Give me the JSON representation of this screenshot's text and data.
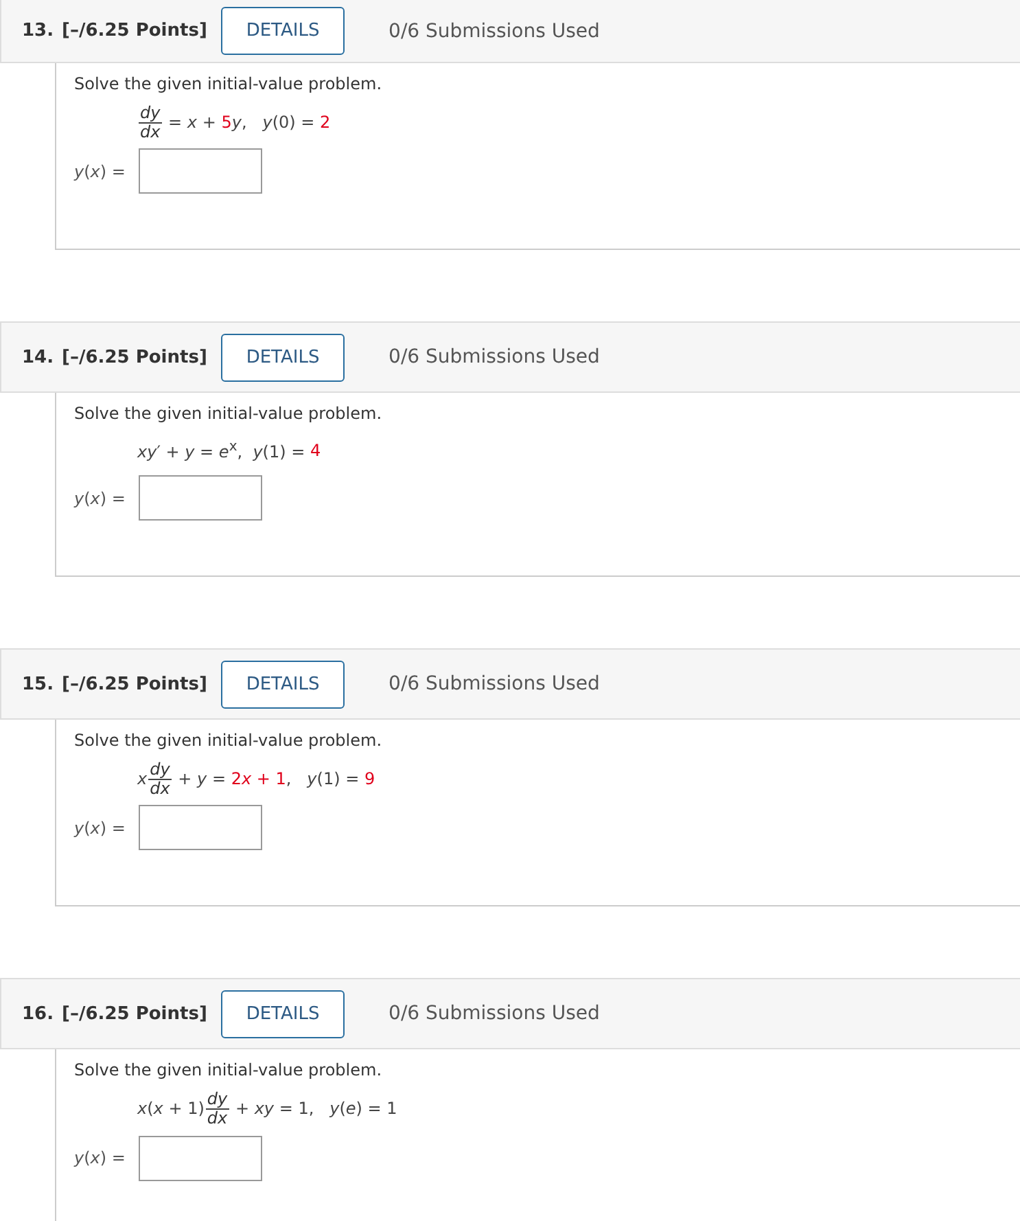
{
  "questions": [
    {
      "number": "13.",
      "points": "[–/6.25 Points]",
      "details_button": "DETAILS",
      "submissions": "0/6 Submissions Used",
      "prompt": "Solve the given initial-value problem.",
      "equation": [
        {
          "kind": "fraction",
          "numerator": "dy",
          "denominator": "dx"
        },
        {
          "kind": "text",
          "text": " = *x* + ",
          "highlight": false
        },
        {
          "kind": "text",
          "text": "5",
          "highlight": true
        },
        {
          "kind": "text",
          "text": "*y*,   *y*(0) = ",
          "highlight": false
        },
        {
          "kind": "text",
          "text": "2",
          "highlight": true
        }
      ],
      "answer_label": "*y*(*x*) ="
    },
    {
      "number": "14.",
      "points": "[–/6.25 Points]",
      "details_button": "DETAILS",
      "submissions": "0/6 Submissions Used",
      "prompt": "Solve the given initial-value problem.",
      "equation": [
        {
          "kind": "text",
          "text": "*xy*′ + *y* = *e*$^{x}$,  *y*(1) = ",
          "highlight": false
        },
        {
          "kind": "text",
          "text": "4",
          "highlight": true
        }
      ],
      "answer_label": "*y*(*x*) ="
    },
    {
      "number": "15.",
      "points": "[–/6.25 Points]",
      "details_button": "DETAILS",
      "submissions": "0/6 Submissions Used",
      "prompt": "Solve the given initial-value problem.",
      "equation": [
        {
          "kind": "text",
          "text": "*x*",
          "highlight": false
        },
        {
          "kind": "fraction",
          "numerator": "dy",
          "denominator": "dx"
        },
        {
          "kind": "text",
          "text": " + *y* = ",
          "highlight": false
        },
        {
          "kind": "text",
          "text": "2",
          "highlight": true
        },
        {
          "kind": "text",
          "text": "*x* + 1",
          "highlight": true
        },
        {
          "kind": "text",
          "text": ",   *y*(1) = ",
          "highlight": false
        },
        {
          "kind": "text",
          "text": "9",
          "highlight": true
        }
      ],
      "answer_label": "*y*(*x*) ="
    },
    {
      "number": "16.",
      "points": "[–/6.25 Points]",
      "details_button": "DETAILS",
      "submissions": "0/6 Submissions Used",
      "prompt": "Solve the given initial-value problem.",
      "equation": [
        {
          "kind": "text",
          "text": "*x*(*x* + 1)",
          "highlight": false
        },
        {
          "kind": "fraction",
          "numerator": "dy",
          "denominator": "dx"
        },
        {
          "kind": "text",
          "text": " + *xy* = 1,   *y*(*e*) = 1",
          "highlight": false
        }
      ],
      "answer_label": "*y*(*x*) ="
    }
  ]
}
